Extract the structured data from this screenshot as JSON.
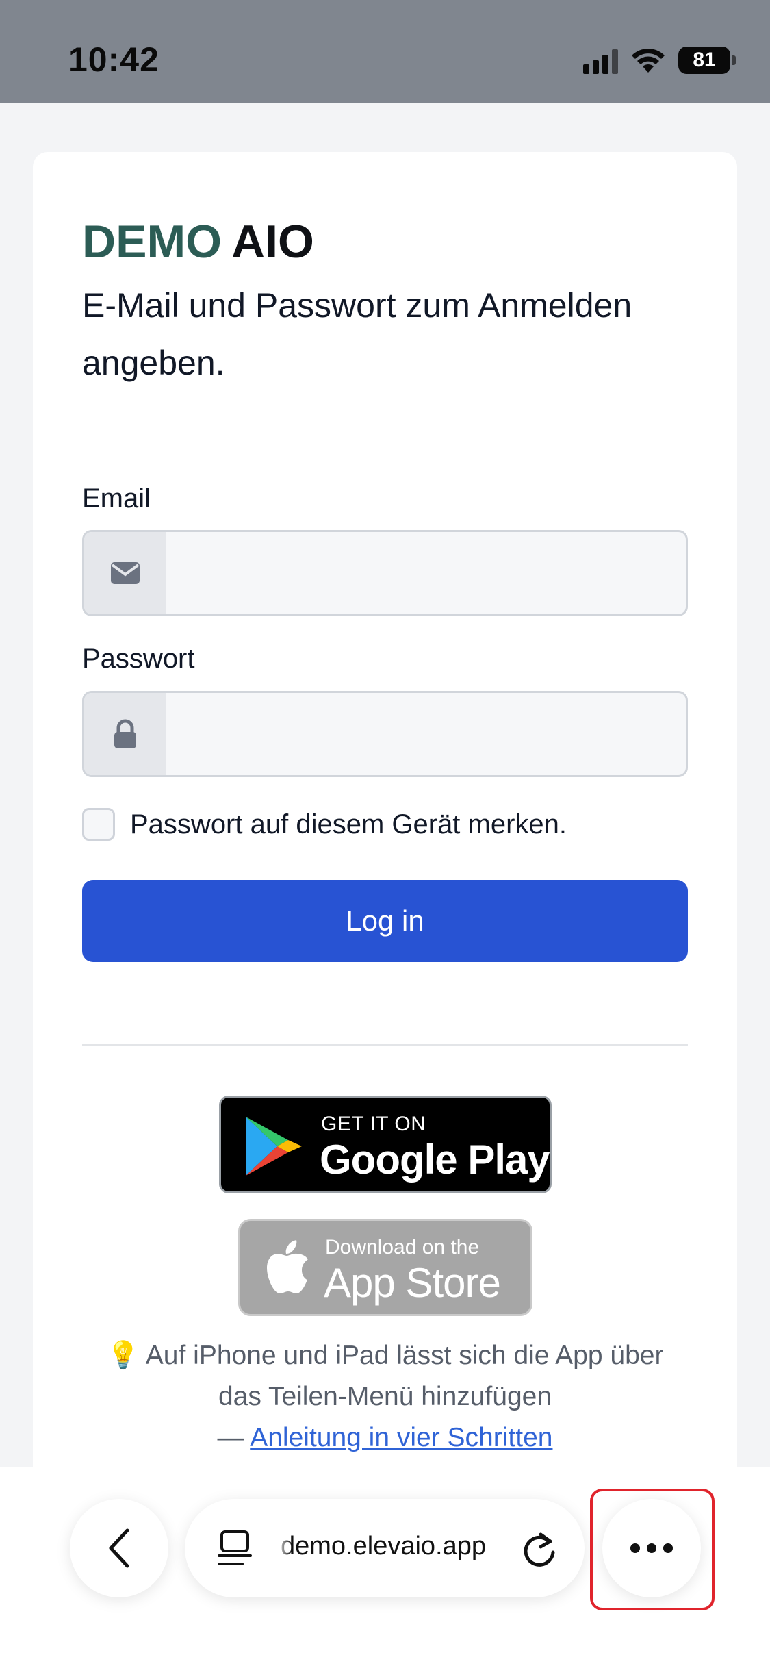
{
  "status_bar": {
    "time": "10:42",
    "battery": "81",
    "icons": [
      "signal-icon",
      "wifi-icon",
      "battery-icon"
    ]
  },
  "login": {
    "brand_primary": "DEMO",
    "brand_secondary": "AIO",
    "subtitle": "E-Mail und Passwort zum Anmelden angeben.",
    "email_label": "Email",
    "email_value": "",
    "email_icon": "envelope-icon",
    "password_label": "Passwort",
    "password_value": "",
    "password_icon": "lock-icon",
    "remember_label": "Passwort auf diesem Gerät merken.",
    "remember_checked": false,
    "login_button": "Log in"
  },
  "stores": {
    "google_small": "GET IT ON",
    "google_big": "Google Play",
    "apple_small": "Download on the",
    "apple_big": "App Store"
  },
  "hint": {
    "emoji": "💡",
    "text": "Auf iPhone und iPad lässt sich die App über das Teilen-Menü hinzufügen",
    "dash": "—",
    "link": "Anleitung in vier Schritten"
  },
  "browser": {
    "url": "demo.elevaio.app",
    "icons": [
      "back-chevron-icon",
      "tabs-icon",
      "reload-icon",
      "more-dots-icon"
    ]
  },
  "colors": {
    "brand": "#2c5c55",
    "primary_button": "#2853d3",
    "highlight": "#e0242c"
  }
}
